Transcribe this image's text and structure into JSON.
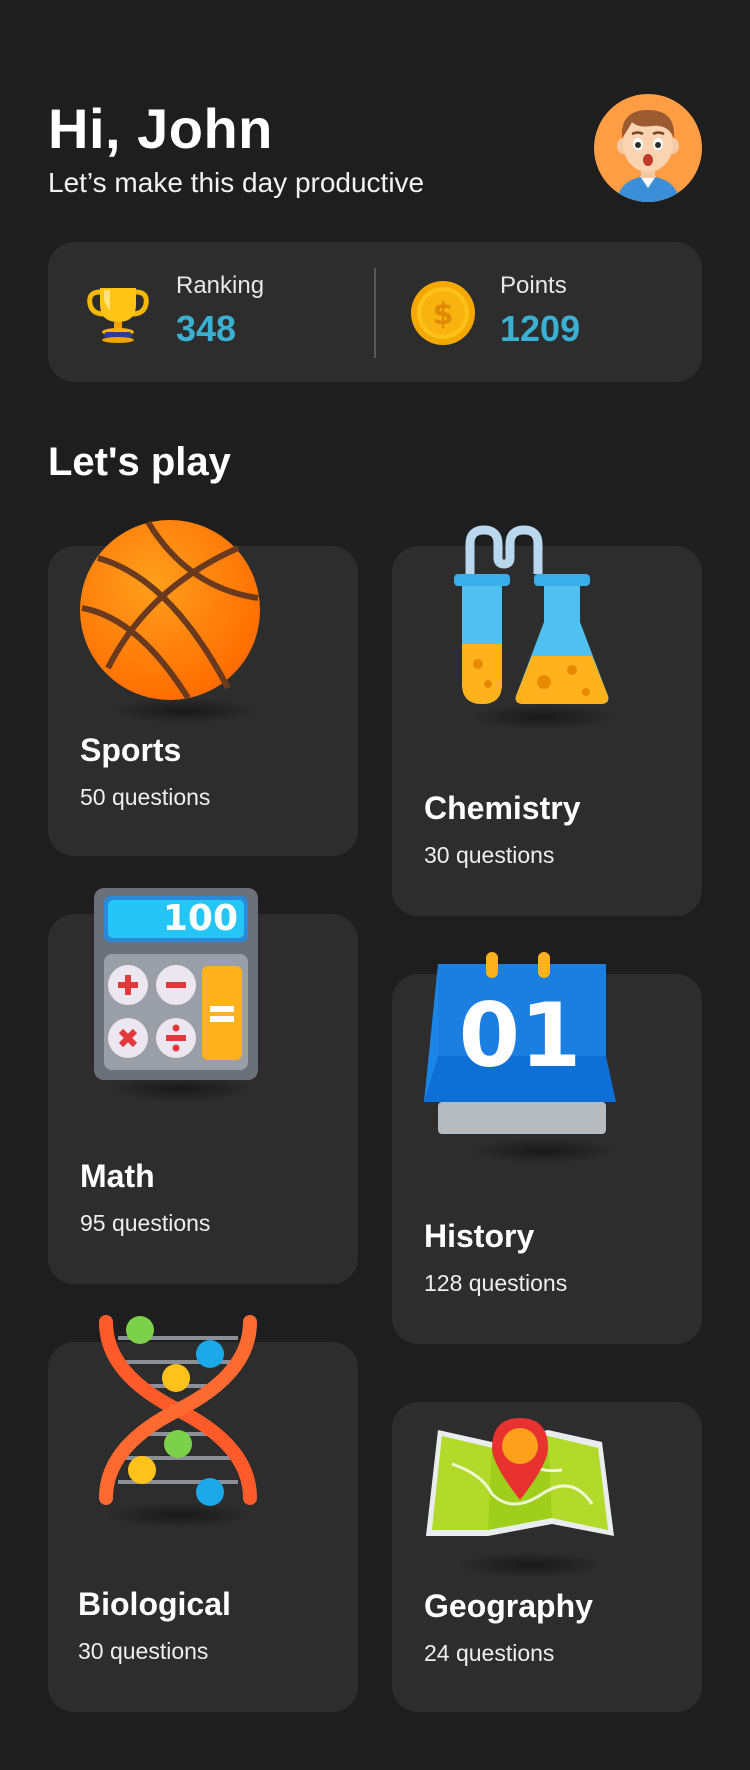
{
  "header": {
    "greeting": "Hi, John",
    "subtitle": "Let’s make this day productive",
    "avatar_icon": "avatar-boy-icon"
  },
  "stats": {
    "ranking": {
      "label": "Ranking",
      "value": "348",
      "icon": "trophy-icon"
    },
    "points": {
      "label": "Points",
      "value": "1209",
      "icon": "coin-icon"
    }
  },
  "section": {
    "title": "Let's play"
  },
  "categories": [
    {
      "name": "Sports",
      "count": "50 questions",
      "icon": "basketball-icon"
    },
    {
      "name": "Chemistry",
      "count": "30 questions",
      "icon": "lab-flask-icon"
    },
    {
      "name": "Math",
      "count": "95 questions",
      "icon": "calculator-icon"
    },
    {
      "name": "History",
      "count": "128 questions",
      "icon": "calendar-icon"
    },
    {
      "name": "Biological",
      "count": "30 questions",
      "icon": "dna-icon"
    },
    {
      "name": "Geography",
      "count": "24 questions",
      "icon": "map-pin-icon"
    }
  ],
  "art_text": {
    "calculator_display": "100",
    "calendar_day": "01"
  },
  "colors": {
    "background": "#1e1e1e",
    "card": "#2d2d2d",
    "accent": "#3ab0d2"
  }
}
